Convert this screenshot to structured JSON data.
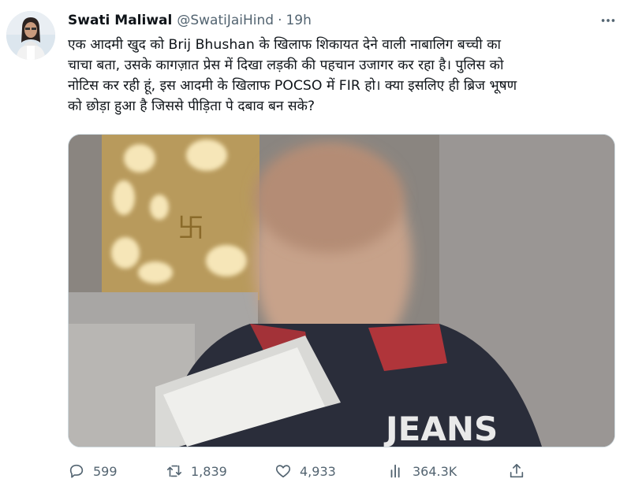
{
  "tweet": {
    "author_name": "Swati Maliwal",
    "handle": "@SwatiJaiHind",
    "separator": "·",
    "time": "19h",
    "text_lines": [
      "एक आदमी खुद को Brij Bhushan के खिलाफ शिकायत देने वाली नाबालिग बच्ची का",
      "चाचा बता, उसके कागज़ात प्रेस में दिखा लड़की की पहचान उजागर कर रहा है। पुलिस को",
      "नोटिस कर रही हूं, इस आदमी के खिलाफ POCSO में FIR हो। क्या इसलिए ही ब्रिज भूषण",
      "को छोड़ा हुआ है जिससे पीड़िता पे दबाव बन सके?"
    ],
    "media_overlay_text": "JEANS"
  },
  "actions": {
    "replies": "599",
    "retweets": "1,839",
    "likes": "4,933",
    "views": "364.3K"
  },
  "icons": {
    "more": "more-dots-icon",
    "reply": "reply-icon",
    "retweet": "retweet-icon",
    "like": "heart-icon",
    "views": "views-chart-icon",
    "share": "share-icon"
  },
  "colors": {
    "text": "#0f1419",
    "secondary": "#536471",
    "border": "#cfd9de"
  }
}
